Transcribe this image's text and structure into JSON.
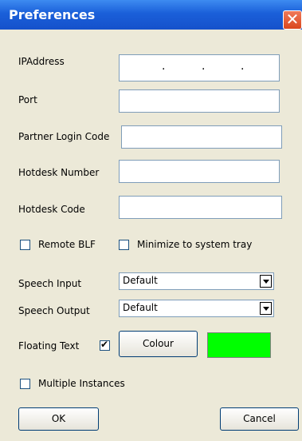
{
  "window": {
    "title": "Preferences",
    "close_glyph": "✕",
    "close_icon": "close-icon"
  },
  "fields": {
    "ip_label": "IPAddress",
    "ip_dots": [
      ".",
      ".",
      "."
    ],
    "port_label": "Port",
    "partner_label": "Partner Login Code",
    "hotdesk_number_label": "Hotdesk Number",
    "hotdesk_code_label": "Hotdesk Code"
  },
  "checkboxes": {
    "remote_blf": {
      "label": "Remote BLF",
      "checked": false
    },
    "minimize_tray": {
      "label": "Minimize to system tray",
      "checked": false
    },
    "floating_text": {
      "label": "Floating Text",
      "checked": true
    },
    "multiple_instances": {
      "label": "Multiple Instances",
      "checked": false
    }
  },
  "speech": {
    "input_label": "Speech Input",
    "input_value": "Default",
    "output_label": "Speech Output",
    "output_value": "Default"
  },
  "colour": {
    "button_label": "Colour",
    "swatch_color": "#00FF00"
  },
  "buttons": {
    "ok": "OK",
    "cancel": "Cancel"
  }
}
